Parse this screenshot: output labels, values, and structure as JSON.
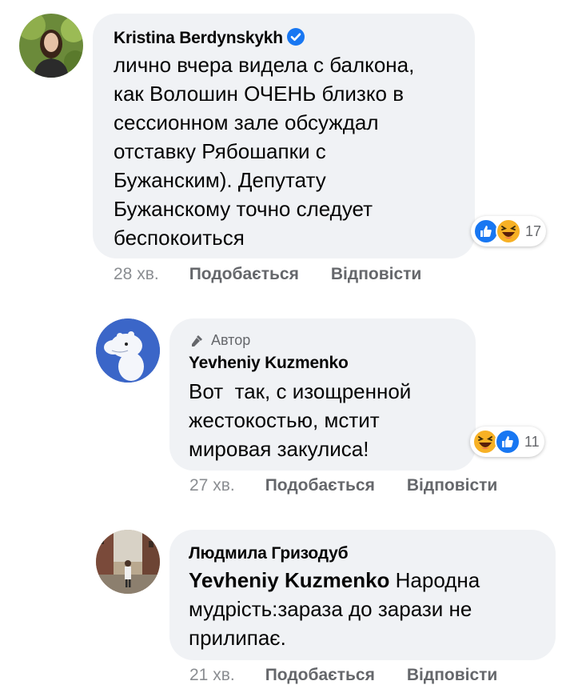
{
  "comments": [
    {
      "author": "Kristina Berdynskykh",
      "verified": true,
      "lines": [
        "лично вчера видела с балкона,",
        "как Волошин ОЧЕНЬ близко в",
        "сессионном зале обсуждал",
        "отставку Рябошапки с",
        "Бужанским). Депутату",
        "Бужанскому точно следует",
        "беспокоиться"
      ],
      "reaction_icons": [
        "like-icon",
        "haha-icon"
      ],
      "reaction_count": "17",
      "time": "28 хв.",
      "like_label": "Подобається",
      "reply_label": "Відповісти"
    },
    {
      "author_badge": "Автор",
      "author": "Yevheniy Kuzmenko",
      "lines": [
        "Вот  так, с изощренной",
        "жестокостью, мстит",
        "мировая закулиса!"
      ],
      "reaction_icons": [
        "haha-icon",
        "like-icon"
      ],
      "reaction_count": "11",
      "time": "27 хв.",
      "like_label": "Подобається",
      "reply_label": "Відповісти"
    },
    {
      "author": "Людмила Гризодуб",
      "mention": "Yevheniy Kuzmenko",
      "first_line_rest": " Народна",
      "lines": [
        "мудрість:зараза до зарази не",
        "прилипає."
      ],
      "time": "21 хв.",
      "like_label": "Подобається",
      "reply_label": "Відповісти"
    }
  ],
  "colors": {
    "bubble": "#f0f2f5",
    "like_blue": "#1877f2",
    "haha_yellow": "#f7b125",
    "meta_gray": "#65676b"
  }
}
